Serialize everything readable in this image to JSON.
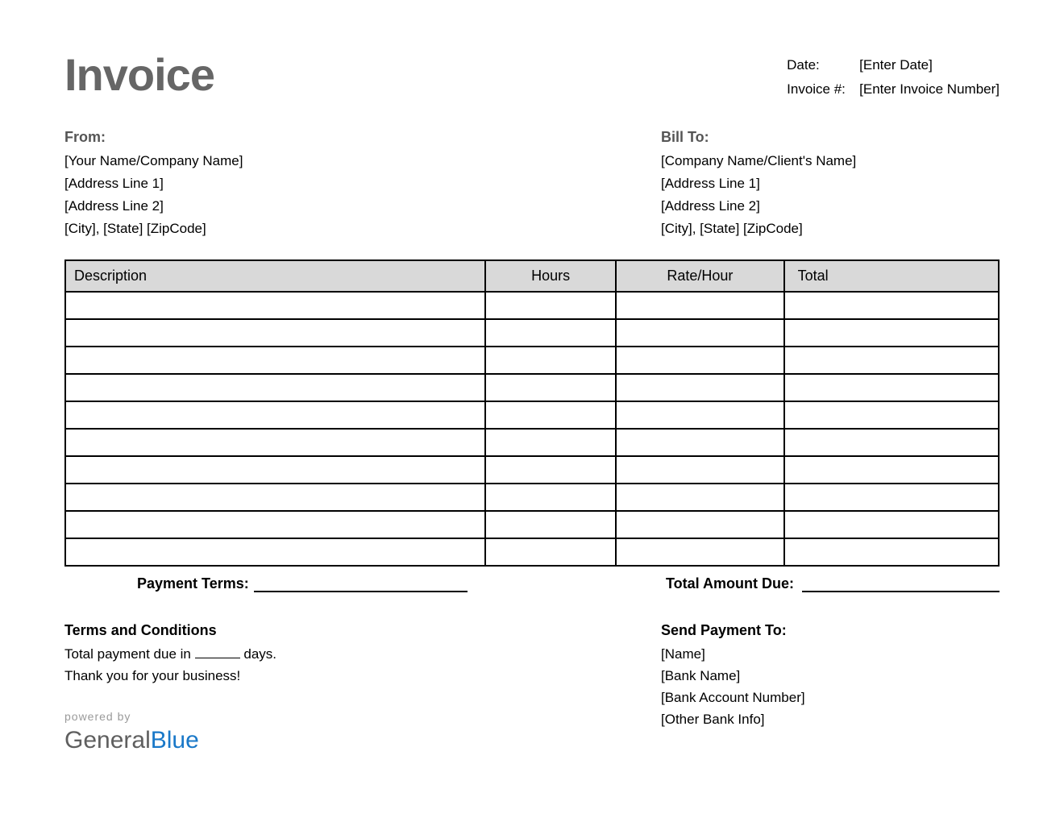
{
  "title": "Invoice",
  "meta": {
    "date_label": "Date:",
    "date_value": "[Enter Date]",
    "invoice_no_label": "Invoice #:",
    "invoice_no_value": "[Enter Invoice Number]"
  },
  "from": {
    "heading": "From:",
    "line1": "[Your Name/Company Name]",
    "line2": "[Address Line 1]",
    "line3": "[Address Line 2]",
    "line4": "[City], [State] [ZipCode]"
  },
  "bill_to": {
    "heading": "Bill To:",
    "line1": "[Company Name/Client's Name]",
    "line2": "[Address Line 1]",
    "line3": "[Address Line 2]",
    "line4": "[City], [State] [ZipCode]"
  },
  "table": {
    "headers": {
      "description": "Description",
      "hours": "Hours",
      "rate": "Rate/Hour",
      "total": "Total"
    },
    "rows": [
      {
        "description": "",
        "hours": "",
        "rate": "",
        "total": ""
      },
      {
        "description": "",
        "hours": "",
        "rate": "",
        "total": ""
      },
      {
        "description": "",
        "hours": "",
        "rate": "",
        "total": ""
      },
      {
        "description": "",
        "hours": "",
        "rate": "",
        "total": ""
      },
      {
        "description": "",
        "hours": "",
        "rate": "",
        "total": ""
      },
      {
        "description": "",
        "hours": "",
        "rate": "",
        "total": ""
      },
      {
        "description": "",
        "hours": "",
        "rate": "",
        "total": ""
      },
      {
        "description": "",
        "hours": "",
        "rate": "",
        "total": ""
      },
      {
        "description": "",
        "hours": "",
        "rate": "",
        "total": ""
      },
      {
        "description": "",
        "hours": "",
        "rate": "",
        "total": ""
      }
    ]
  },
  "payment_terms_label": "Payment Terms:",
  "total_amount_due_label": "Total Amount Due:",
  "terms": {
    "heading": "Terms and Conditions",
    "line1a": "Total payment due in",
    "line1b": "days.",
    "line2": "Thank you for your business!"
  },
  "send_payment_to": {
    "heading": "Send Payment To:",
    "line1": "[Name]",
    "line2": "[Bank Name]",
    "line3": "[Bank Account Number]",
    "line4": "[Other Bank Info]"
  },
  "footer": {
    "powered_by": "powered by",
    "brand_general": "General",
    "brand_blue": "Blue"
  }
}
